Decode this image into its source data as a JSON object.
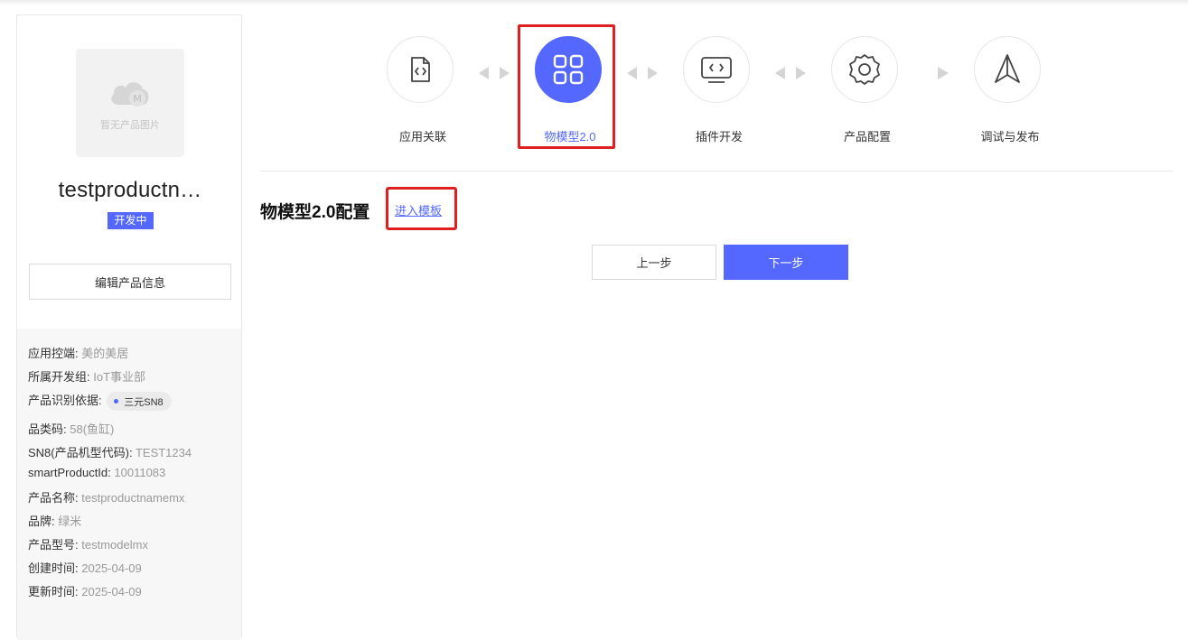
{
  "product": {
    "image_placeholder": "暂无产品图片",
    "name": "testproductn…",
    "status": "开发中",
    "edit_label": "编辑产品信息"
  },
  "info": {
    "app_control": {
      "key": "应用控端:",
      "value": "美的美居"
    },
    "dev_group": {
      "key": "所属开发组:",
      "value": "IoT事业部"
    },
    "id_basis": {
      "key": "产品识别依据:",
      "value": "三元SN8"
    },
    "category_code": {
      "key": "品类码:",
      "value": "58(鱼缸)"
    },
    "sn8": {
      "key": "SN8(产品机型代码):",
      "value": "TEST1234"
    },
    "smart_product_id": {
      "key": "smartProductId:",
      "value": "10011083"
    },
    "product_name": {
      "key": "产品名称:",
      "value": "testproductnamemx"
    },
    "brand": {
      "key": "品牌:",
      "value": "绿米"
    },
    "model": {
      "key": "产品型号:",
      "value": "testmodelmx"
    },
    "created": {
      "key": "创建时间:",
      "value": "2025-04-09"
    },
    "updated": {
      "key": "更新时间:",
      "value": "2025-04-09"
    }
  },
  "steps": [
    {
      "label": "应用关联",
      "icon": "code-file-icon",
      "active": false
    },
    {
      "label": "物模型2.0",
      "icon": "grid-icon",
      "active": true
    },
    {
      "label": "插件开发",
      "icon": "monitor-code-icon",
      "active": false
    },
    {
      "label": "产品配置",
      "icon": "gear-icon",
      "active": false
    },
    {
      "label": "调试与发布",
      "icon": "paper-plane-icon",
      "active": false
    }
  ],
  "section": {
    "title": "物模型2.0配置",
    "template_link": "进入模板"
  },
  "buttons": {
    "prev": "上一步",
    "next": "下一步"
  },
  "colors": {
    "accent": "#5468ff",
    "highlight": "#e02020"
  }
}
